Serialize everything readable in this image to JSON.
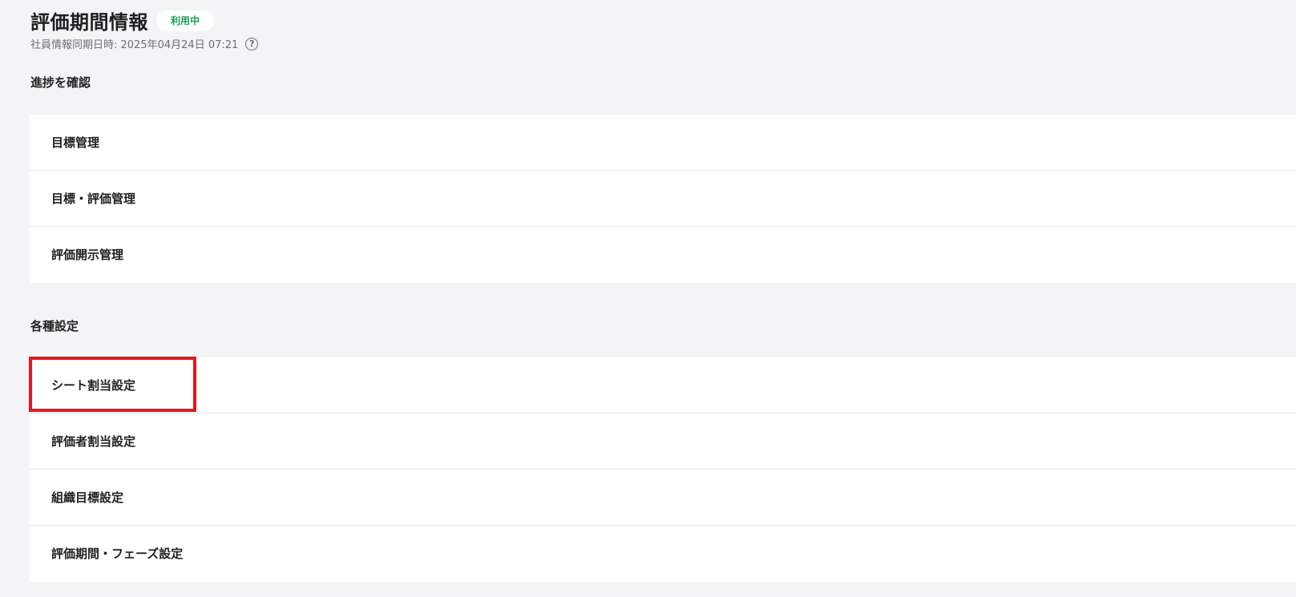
{
  "header": {
    "title": "評価期間情報",
    "status_badge": "利用中",
    "sync_text": "社員情報同期日時: 2025年04月24日 07:21",
    "help_icon": "question-circle-icon"
  },
  "progress_section": {
    "heading": "進捗を確認",
    "items": [
      {
        "label": "目標管理"
      },
      {
        "label": "目標・評価管理"
      },
      {
        "label": "評価開示管理"
      }
    ]
  },
  "settings_section": {
    "heading": "各種設定",
    "items": [
      {
        "label": "シート割当設定"
      },
      {
        "label": "評価者割当設定"
      },
      {
        "label": "組織目標設定"
      },
      {
        "label": "評価期間・フェーズ設定"
      }
    ]
  },
  "colors": {
    "background": "#f3f4f6",
    "badge_text": "#18a058",
    "highlight": "#e8141e"
  }
}
